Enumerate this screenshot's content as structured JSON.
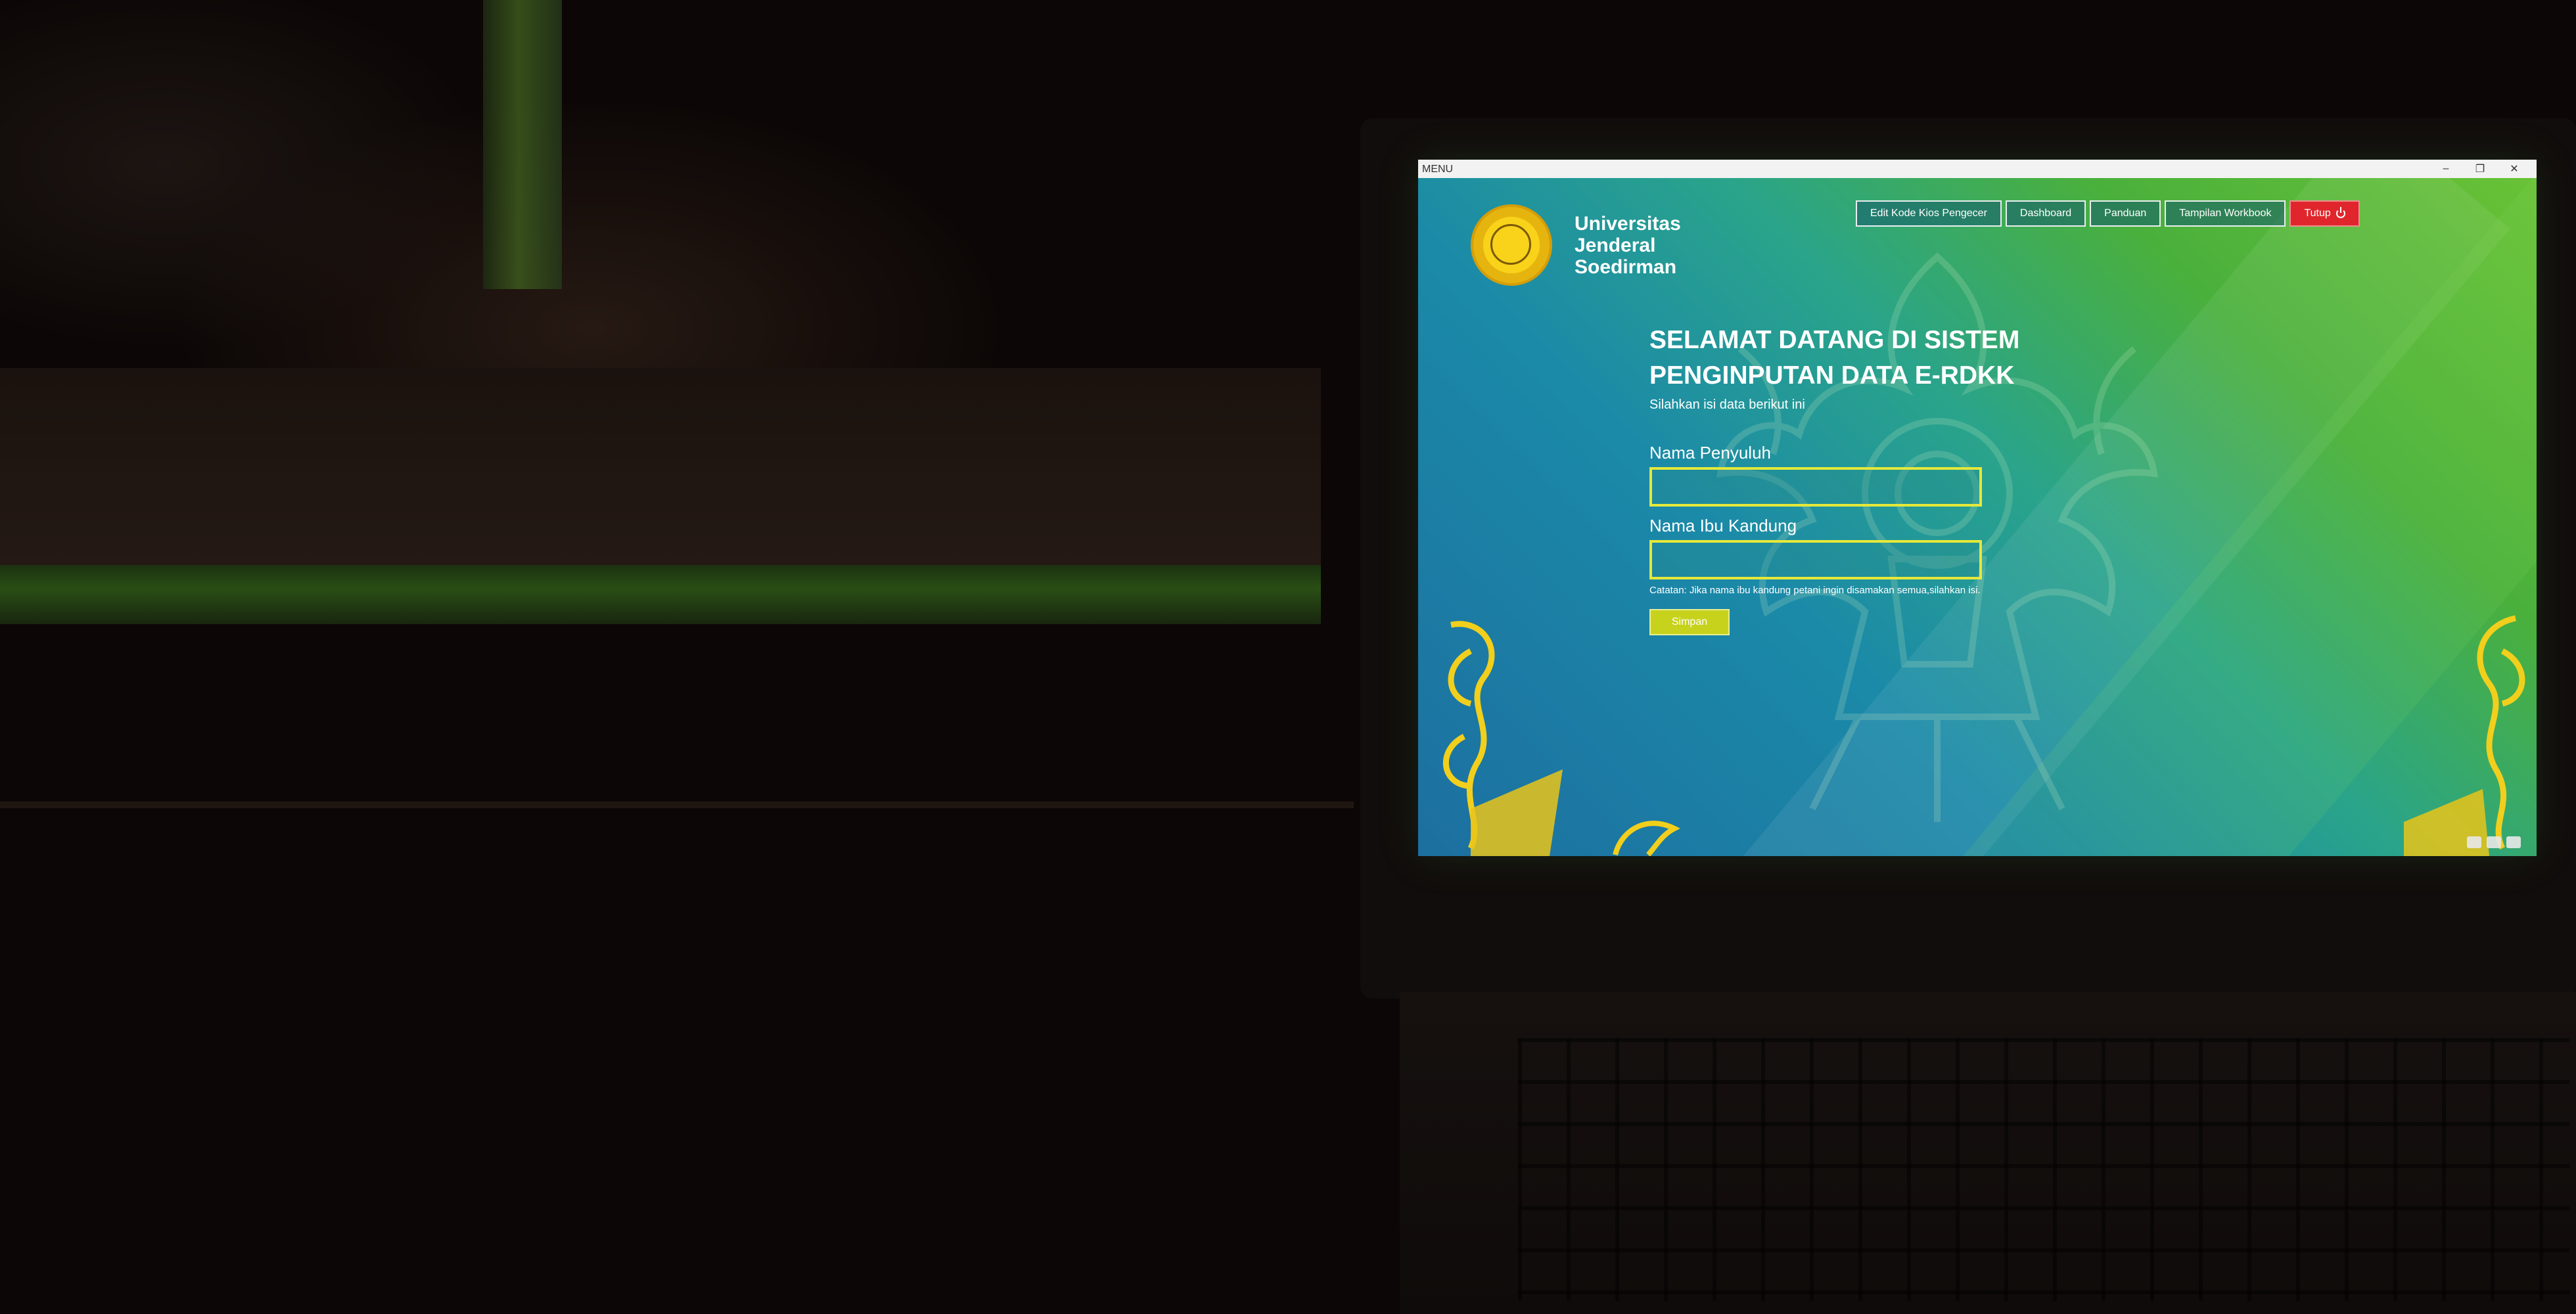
{
  "window": {
    "title": "MENU",
    "minimize_icon": "minimize-icon",
    "maximize_icon": "restore-icon",
    "close_icon": "close-icon"
  },
  "logo": {
    "line1": "Universitas",
    "line2": "Jenderal",
    "line3": "Soedirman"
  },
  "nav": {
    "items": [
      {
        "label": "Edit Kode Kios Pengecer"
      },
      {
        "label": "Dashboard"
      },
      {
        "label": "Panduan"
      },
      {
        "label": "Tampilan Workbook"
      }
    ],
    "close_label": "Tutup",
    "close_icon": "power-icon"
  },
  "form": {
    "title": "SELAMAT DATANG DI SISTEM PENGINPUTAN DATA E-RDKK",
    "subtitle": "Silahkan isi data berikut ini",
    "field1_label": "Nama Penyuluh",
    "field1_value": "",
    "field2_label": "Nama Ibu Kandung",
    "field2_value": "",
    "note": "Catatan: Jika nama ibu kandung petani ingin disamakan semua,silahkan isi.",
    "save_label": "Simpan"
  },
  "colors": {
    "accent_yellow": "#e5e83a",
    "close_red": "#e0262c",
    "save_olive": "#c7d21c"
  }
}
